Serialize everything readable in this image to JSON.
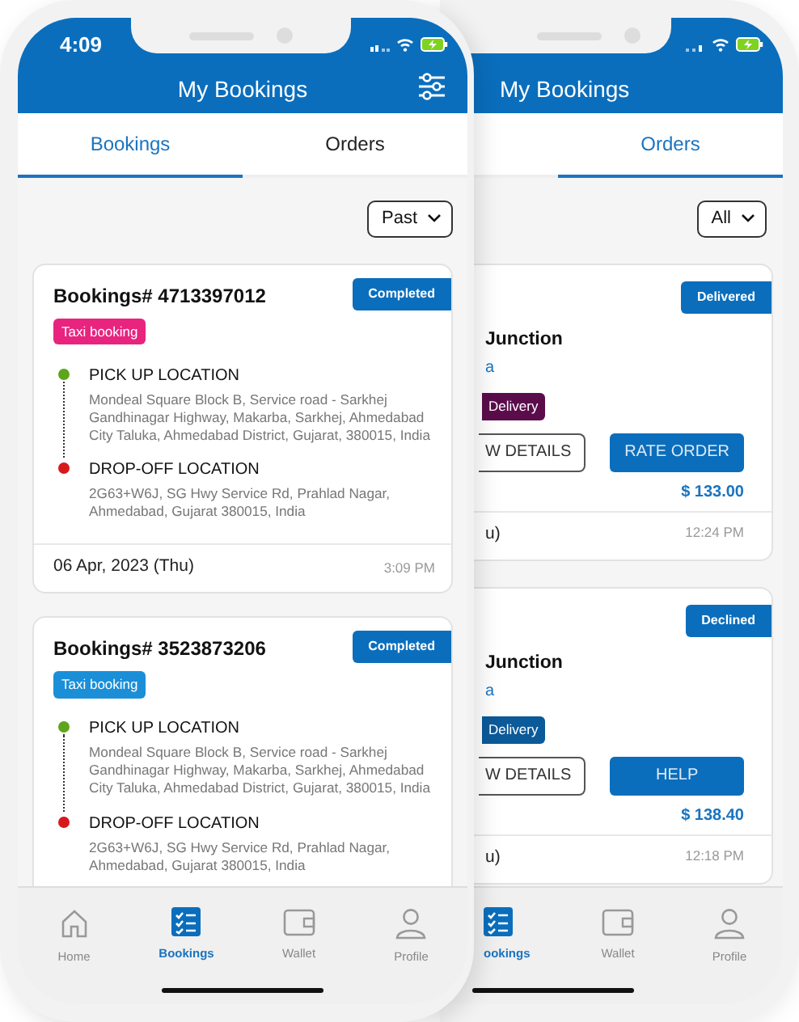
{
  "front_phone": {
    "status_bar": {
      "time": "4:09"
    },
    "title": "My Bookings",
    "tabs": [
      {
        "label": "Bookings",
        "selected": true
      },
      {
        "label": "Orders",
        "selected": false
      }
    ],
    "filter": {
      "value": "Past"
    },
    "bookings": [
      {
        "number": "Bookings# 4713397012",
        "type": {
          "label": "Taxi booking",
          "color": "#e8247f"
        },
        "status": "Completed",
        "pickup_label": "PICK UP LOCATION",
        "pickup_address": "Mondeal Square Block B, Service road - Sarkhej Gandhinagar Highway, Makarba, Sarkhej, Ahmedabad City Taluka, Ahmedabad District, Gujarat, 380015, India",
        "dropoff_label": "DROP-OFF LOCATION",
        "dropoff_address": "2G63+W6J, SG Hwy Service Rd, Prahlad Nagar, Ahmedabad, Gujarat 380015, India",
        "date": "06 Apr, 2023 (Thu)",
        "time": "3:09 PM"
      },
      {
        "number": "Bookings# 3523873206",
        "type": {
          "label": "Taxi booking",
          "color": "#1a8fd8"
        },
        "status": "Completed",
        "pickup_label": "PICK UP LOCATION",
        "pickup_address": "Mondeal Square Block B, Service road - Sarkhej Gandhinagar Highway, Makarba, Sarkhej, Ahmedabad City Taluka, Ahmedabad District, Gujarat, 380015, India",
        "dropoff_label": "DROP-OFF LOCATION",
        "dropoff_address": "2G63+W6J, SG Hwy Service Rd, Prahlad Nagar, Ahmedabad, Gujarat 380015, India"
      }
    ],
    "nav": [
      {
        "label": "Home",
        "selected": false
      },
      {
        "label": "Bookings",
        "selected": true
      },
      {
        "label": "Wallet",
        "selected": false
      },
      {
        "label": "Profile",
        "selected": false
      }
    ]
  },
  "back_phone": {
    "title": "My Bookings",
    "tabs": [
      {
        "label": "Orders",
        "selected": true
      }
    ],
    "filter": {
      "value": "All"
    },
    "orders": [
      {
        "status": "Delivered",
        "name": "Junction",
        "store": "a",
        "tag": {
          "label": "Delivery",
          "color": "#5b0c4b"
        },
        "buttons": [
          {
            "label": "W DETAILS",
            "kind": "outline"
          },
          {
            "label": "RATE ORDER",
            "kind": "filled"
          }
        ],
        "price": "$ 133.00",
        "date": "u)",
        "time": "12:24 PM"
      },
      {
        "status": "Declined",
        "name": "Junction",
        "store": "a",
        "tag": {
          "label": "Delivery",
          "color": "#0b5a99"
        },
        "buttons": [
          {
            "label": "W DETAILS",
            "kind": "outline"
          },
          {
            "label": "HELP",
            "kind": "filled"
          }
        ],
        "price": "$ 138.40",
        "date": "u)",
        "time": "12:18 PM"
      }
    ],
    "nav": [
      {
        "label": "ookings",
        "selected": true
      },
      {
        "label": "Wallet",
        "selected": false
      },
      {
        "label": "Profile",
        "selected": false
      }
    ]
  }
}
